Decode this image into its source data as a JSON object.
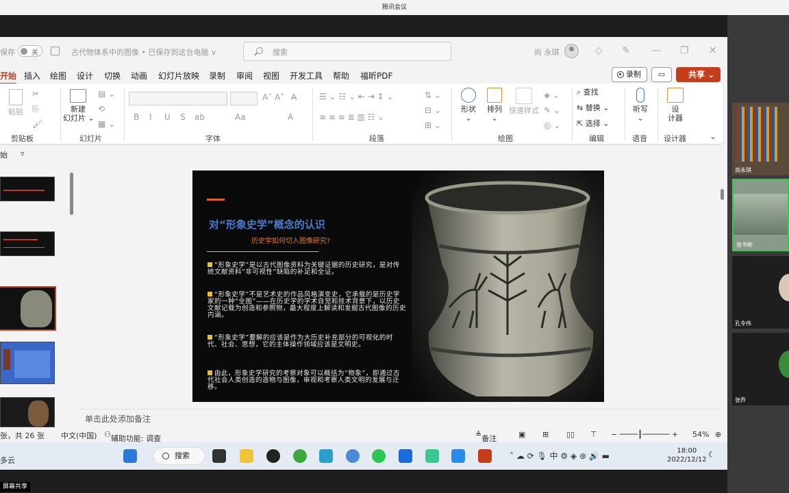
{
  "window_title": "腾讯会议",
  "screen_share_label": "屏幕共享",
  "powerpoint": {
    "autosave_label": "保存",
    "autosave_state": "关",
    "doc_title": "古代物体系中的图像 • 已保存到这台电脑 ∨",
    "search_placeholder": "搜索",
    "user_name": "尚 永琪",
    "tabs": [
      "开始",
      "插入",
      "绘图",
      "设计",
      "切换",
      "动画",
      "幻灯片放映",
      "录制",
      "审阅",
      "视图",
      "开发工具",
      "帮助",
      "福昕PDF"
    ],
    "record_button": "录制",
    "share_button": "共享",
    "ribbon": {
      "paste": "粘贴",
      "new_slide": "新建\n幻灯片 ⌄",
      "groups": [
        "剪贴板",
        "幻灯片",
        "字体",
        "段落",
        "绘图",
        "编辑",
        "语音",
        "设计器"
      ],
      "shape": "形状",
      "arrange": "排列",
      "quick_style": "快速样式",
      "find": "查找",
      "replace": "替换",
      "select": "选择",
      "dictate": "听写",
      "designer": "设\n计器",
      "font_buttons": [
        "B",
        "I",
        "U",
        "S",
        "ab",
        "Aa",
        "A"
      ]
    },
    "qat_label": "始",
    "slide": {
      "title": "对“形象史学”概念的认识",
      "subtitle": "历史学如何切入图像研究?",
      "paragraphs": [
        "“形象史学”是以古代图像资料为关键证据的历史研究，是对传统文献资料“非可视性”缺陷的补足和全证。",
        "“形象史学”不是艺术史的作品风格演变史，它承载的是历史学家的一种“全图”——在历史学的学术自觉和技术背景下，以历史文献记载为创造和参照物，最大程度上解读和发掘古代图像的历史内涵。",
        "“形象史学”要解的应该是作为大历史补充部分的可视化的时代、社会、思想，它的主体操作领域应该是文明史。",
        "由此，形象史学研究的考察对象可以概括为“物象”，即通过古代社会人类创造的造物与图像，审视和考察人类文明的发展与迁移。"
      ]
    },
    "notes_placeholder": "单击此处添加备注",
    "status": {
      "slide_count": "张，共 26 张",
      "language": "中文(中国)",
      "accessibility": "辅助功能: 调查",
      "notes_btn": "备注",
      "zoom": "54%"
    }
  },
  "taskbar": {
    "weather": "多云",
    "search": "搜索",
    "time": "18:00",
    "date": "2022/12/12"
  },
  "participants": [
    {
      "name": "尚永琪"
    },
    {
      "name": "张书彬"
    },
    {
      "name": "孔令伟"
    },
    {
      "name": "张乔"
    }
  ],
  "colors": {
    "accent": "#c43e1c",
    "title_blue": "#4a7bd0",
    "subtitle_orange": "#e07a2a"
  }
}
